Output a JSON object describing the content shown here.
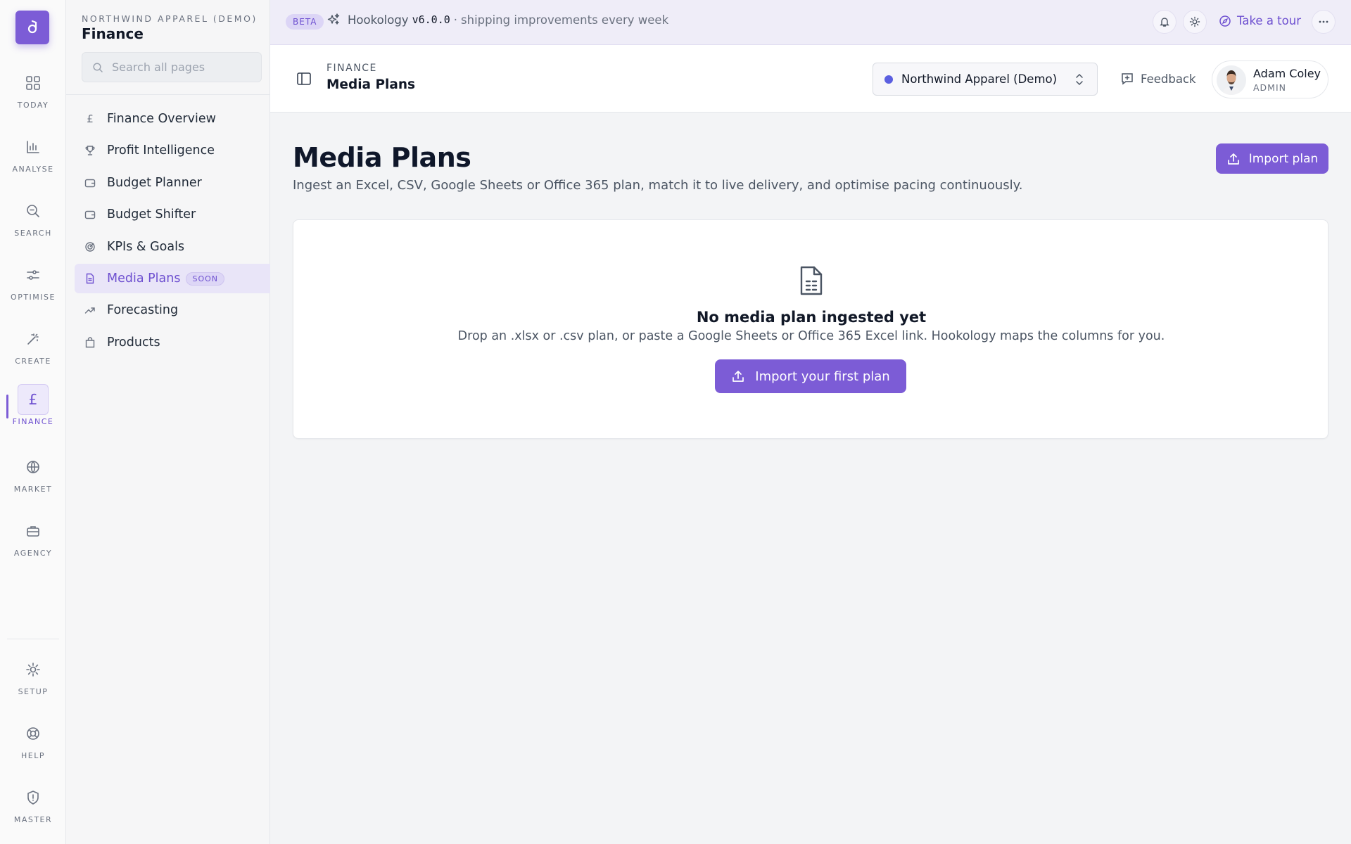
{
  "rail": {
    "items": [
      {
        "label": "TODAY",
        "icon": "grid-icon"
      },
      {
        "label": "ANALYSE",
        "icon": "bar-chart-icon"
      },
      {
        "label": "SEARCH",
        "icon": "search-icon"
      },
      {
        "label": "OPTIMISE",
        "icon": "sliders-icon"
      },
      {
        "label": "CREATE",
        "icon": "magic-wand-icon"
      },
      {
        "label": "FINANCE",
        "icon": "pound-icon",
        "active": true
      },
      {
        "label": "MARKET",
        "icon": "globe-icon"
      },
      {
        "label": "AGENCY",
        "icon": "briefcase-icon"
      }
    ],
    "bottom": [
      {
        "label": "SETUP",
        "icon": "sun-gear-icon"
      },
      {
        "label": "HELP",
        "icon": "lifebuoy-icon"
      },
      {
        "label": "MASTER",
        "icon": "shield-icon"
      }
    ]
  },
  "sidebar": {
    "org": "NORTHWIND APPAREL (DEMO)",
    "title": "Finance",
    "search_placeholder": "Search all pages",
    "items": [
      {
        "label": "Finance Overview",
        "icon": "pound-icon"
      },
      {
        "label": "Profit Intelligence",
        "icon": "trophy-icon"
      },
      {
        "label": "Budget Planner",
        "icon": "wallet-icon"
      },
      {
        "label": "Budget Shifter",
        "icon": "wallet-icon"
      },
      {
        "label": "KPIs & Goals",
        "icon": "target-icon"
      },
      {
        "label": "Media Plans",
        "icon": "document-icon",
        "active": true,
        "badge": "SOON"
      },
      {
        "label": "Forecasting",
        "icon": "trend-up-icon"
      },
      {
        "label": "Products",
        "icon": "shopping-bag-icon"
      }
    ]
  },
  "banner": {
    "beta": "BETA",
    "product": "Hookology",
    "version": "v6.0.0",
    "separator": "·",
    "tagline": "shipping improvements every week",
    "tour": "Take a tour"
  },
  "header": {
    "section": "FINANCE",
    "title": "Media Plans",
    "org_select": "Northwind Apparel (Demo)",
    "feedback": "Feedback",
    "user_name": "Adam Coley",
    "user_role": "ADMIN"
  },
  "main": {
    "title": "Media Plans",
    "subtitle": "Ingest an Excel, CSV, Google Sheets or Office 365 plan, match it to live delivery, and optimise pacing continuously.",
    "import_button": "Import plan",
    "empty": {
      "title": "No media plan ingested yet",
      "text": "Drop an .xlsx or .csv plan, or paste a Google Sheets or Office 365 Excel link. Hookology maps the columns for you.",
      "button": "Import your first plan"
    }
  },
  "colors": {
    "accent": "#7c5cd6",
    "org_dot": "#5b5fe0"
  }
}
